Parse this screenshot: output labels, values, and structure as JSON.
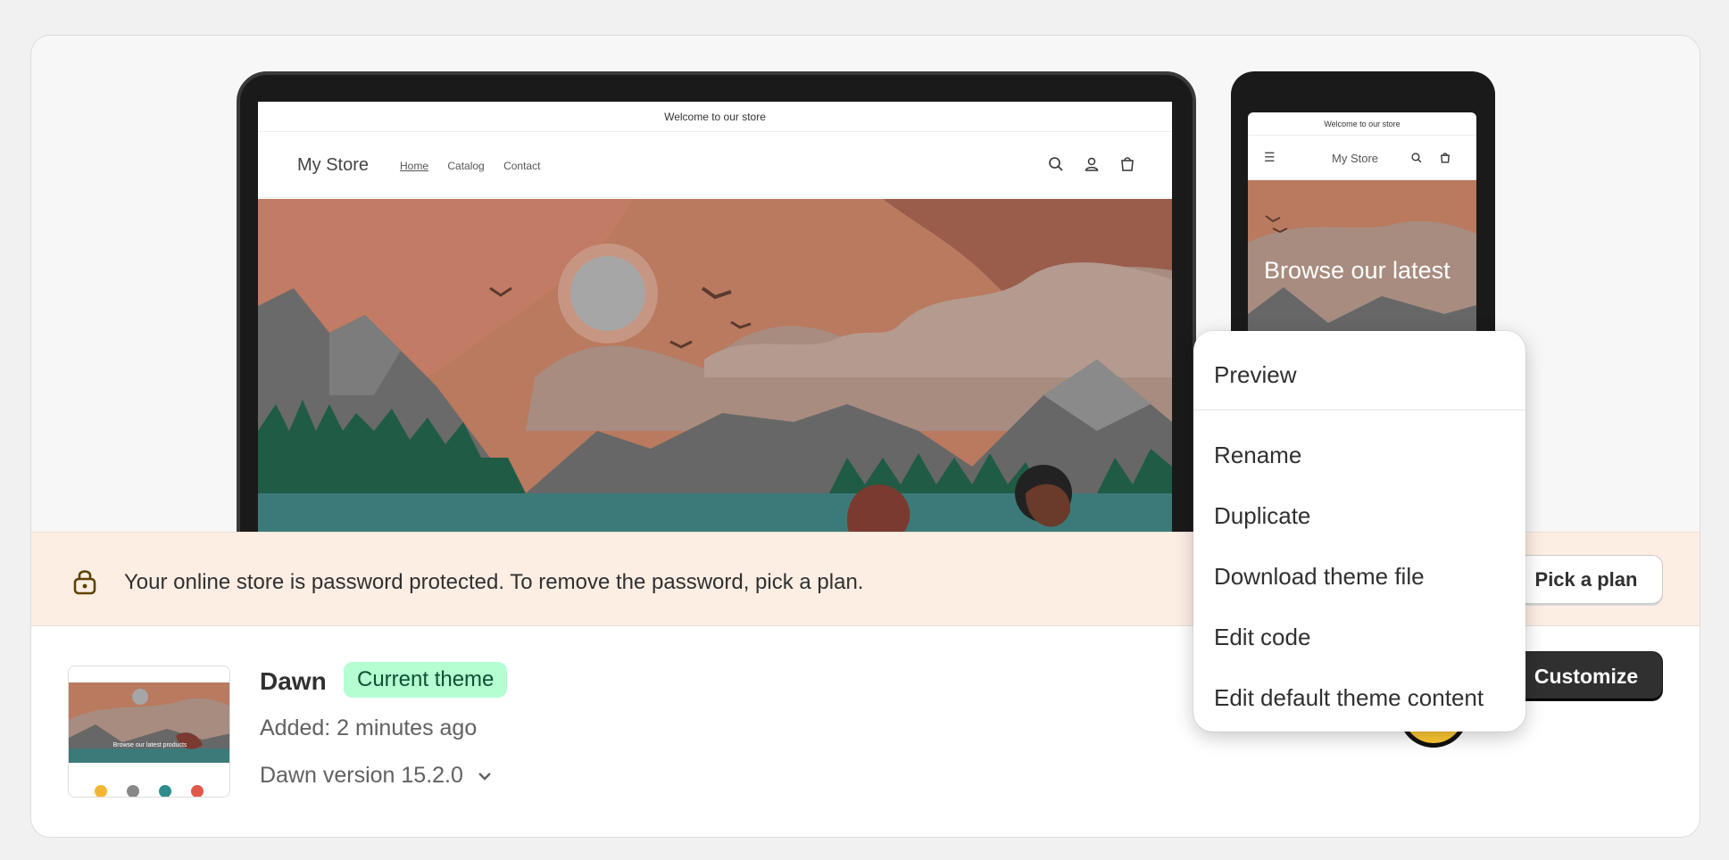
{
  "store_preview": {
    "announcement": "Welcome to our store",
    "store_name": "My Store",
    "nav_links": [
      "Home",
      "Catalog",
      "Contact"
    ],
    "mobile_announcement": "Welcome to our store",
    "mobile_store_name": "My Store",
    "mobile_hero_text": "Browse our latest"
  },
  "banner": {
    "message": "Your online store is password protected. To remove the password, pick a plan.",
    "button_label": "Pick a plan"
  },
  "theme": {
    "name": "Dawn",
    "badge": "Current theme",
    "added": "Added: 2 minutes ago",
    "version": "Dawn version 15.2.0",
    "more_label": "•••",
    "customize_label": "Customize"
  },
  "menu": {
    "items": [
      "Preview",
      "Rename",
      "Duplicate",
      "Download theme file",
      "Edit code",
      "Edit default theme content"
    ]
  },
  "colors": {
    "badge_bg": "#b4fed2",
    "banner_bg": "#fdeee4",
    "cursor": "#ffc933"
  },
  "icons": [
    "search-icon",
    "account-icon",
    "cart-icon",
    "menu-icon",
    "lock-icon",
    "chevron-down-icon"
  ]
}
